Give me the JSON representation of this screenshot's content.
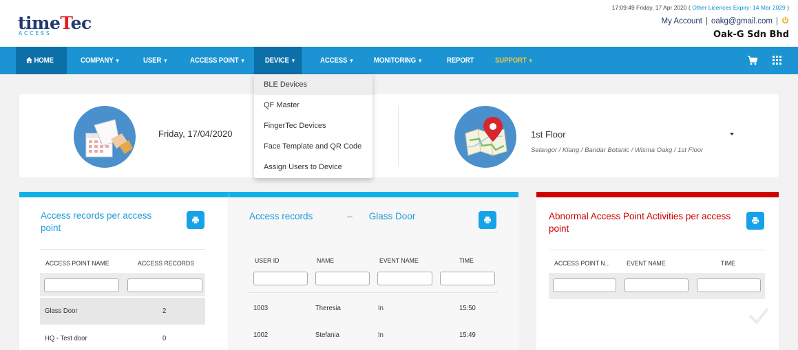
{
  "header": {
    "logo": {
      "prefix": "time",
      "mid": "T",
      "suffix": "ec",
      "sub": "ACCESS"
    },
    "datetime": "17:09:49 Friday, 17 Apr 2020 (",
    "licence": "Other Licences Expiry: 14 Mar 2029",
    "datetime_close": ")",
    "my_account": "My Account",
    "email": "oakg@gmail.com",
    "separator": "|",
    "company": "Oak-G Sdn Bhd",
    "power_icon": "power-icon"
  },
  "nav": {
    "home": "HOME",
    "company": "COMPANY",
    "user": "USER",
    "access_point": "ACCESS POINT",
    "device": "DEVICE",
    "access": "ACCESS",
    "monitoring": "MONITORING",
    "report": "REPORT",
    "support": "SUPPORT",
    "caret": "▼",
    "home_icon": "home-icon",
    "cart_icon": "cart-icon",
    "apps_icon": "apps-grid-icon"
  },
  "device_menu": [
    "BLE Devices",
    "QF Master",
    "FingerTec Devices",
    "Face Template and QR Code",
    "Assign Users to Device"
  ],
  "info": {
    "date": "Friday, 17/04/2020",
    "floor": "1st Floor",
    "floor_path": "Selangor / Klang / Bandar Botanic / Wisma Oakg / 1st Floor"
  },
  "panel_access_point": {
    "title": "Access records per access point",
    "columns": [
      "ACCESS POINT NAME",
      "ACCESS RECORDS"
    ],
    "rows": [
      {
        "name": "Glass Door",
        "records": "2"
      },
      {
        "name": "HQ - Test door",
        "records": "0"
      }
    ]
  },
  "panel_records": {
    "title": "Access records",
    "dash": "–",
    "door": "Glass Door",
    "columns": [
      "USER ID",
      "NAME",
      "EVENT NAME",
      "TIME"
    ],
    "rows": [
      {
        "id": "1003",
        "name": "Theresia",
        "event": "In",
        "time": "15:50"
      },
      {
        "id": "1002",
        "name": "Stefania",
        "event": "In",
        "time": "15:49"
      }
    ]
  },
  "panel_abnormal": {
    "title": "Abnormal Access Point Activities per access point",
    "columns": [
      "ACCESS POINT N...",
      "EVENT NAME",
      "TIME"
    ]
  },
  "colors": {
    "nav": "#1c93d2",
    "nav_active": "#0d6fa8",
    "accent_blue": "#12b0e8",
    "accent_red": "#d00000",
    "support": "#f4c244",
    "power": "#f5a000"
  }
}
